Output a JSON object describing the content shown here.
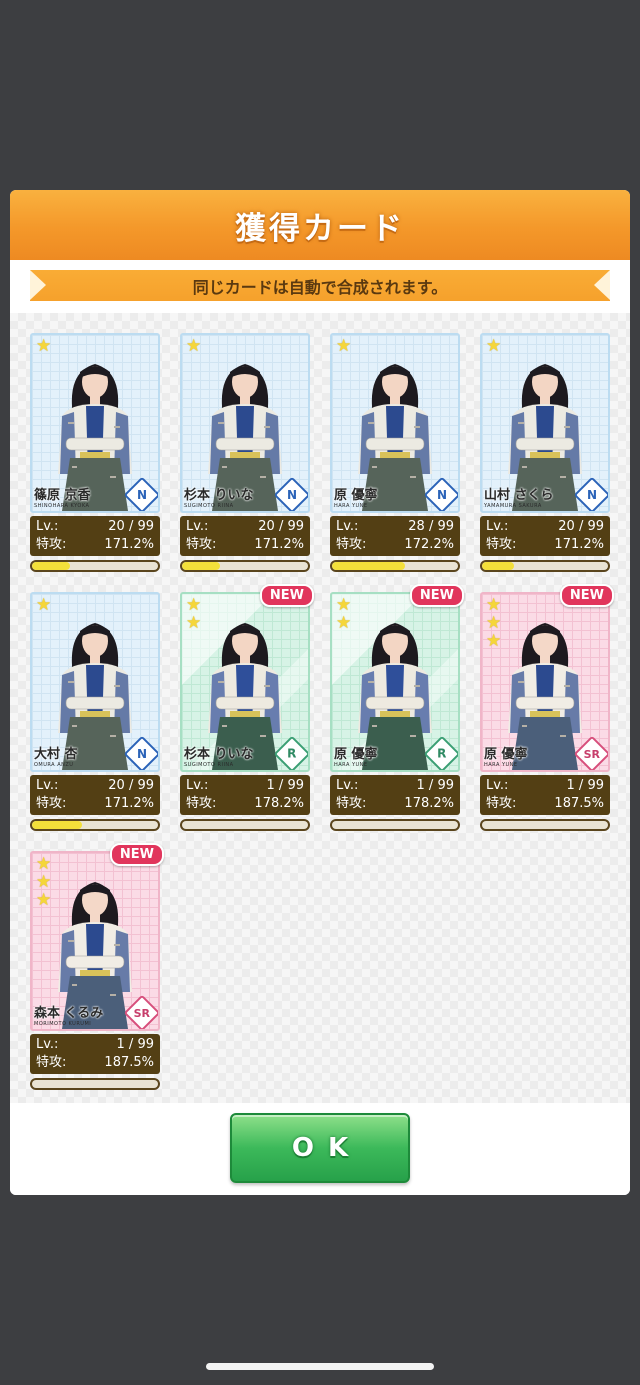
{
  "header": {
    "title": "獲得カード"
  },
  "notice": {
    "text": "同じカードは自動で合成されます。"
  },
  "labels": {
    "level": "Lv.:",
    "attack": "特攻:"
  },
  "cards": [
    {
      "name_jp": "篠原 京香",
      "name_en": "SHINOHARA KYOKA",
      "rarity": "N",
      "stars": 1,
      "new": false,
      "level": "20 / 99",
      "attack": "171.2%",
      "xp": 0.3,
      "palette": "blue"
    },
    {
      "name_jp": "杉本 りいな",
      "name_en": "SUGIMOTO RIINA",
      "rarity": "N",
      "stars": 1,
      "new": false,
      "level": "20 / 99",
      "attack": "171.2%",
      "xp": 0.3,
      "palette": "blue"
    },
    {
      "name_jp": "原 優寧",
      "name_en": "HARA YUNE",
      "rarity": "N",
      "stars": 1,
      "new": false,
      "level": "28 / 99",
      "attack": "172.2%",
      "xp": 0.58,
      "palette": "blue"
    },
    {
      "name_jp": "山村 さくら",
      "name_en": "YAMAMURA SAKURA",
      "rarity": "N",
      "stars": 1,
      "new": false,
      "level": "20 / 99",
      "attack": "171.2%",
      "xp": 0.25,
      "palette": "blue"
    },
    {
      "name_jp": "大村 杏",
      "name_en": "OMURA ANZU",
      "rarity": "N",
      "stars": 1,
      "new": false,
      "level": "20 / 99",
      "attack": "171.2%",
      "xp": 0.4,
      "palette": "blue"
    },
    {
      "name_jp": "杉本 りいな",
      "name_en": "SUGIMOTO RIINA",
      "rarity": "R",
      "stars": 2,
      "new": true,
      "level": "1 / 99",
      "attack": "178.2%",
      "xp": 0,
      "palette": "green"
    },
    {
      "name_jp": "原 優寧",
      "name_en": "HARA YUNE",
      "rarity": "R",
      "stars": 2,
      "new": true,
      "level": "1 / 99",
      "attack": "178.2%",
      "xp": 0,
      "palette": "green"
    },
    {
      "name_jp": "原 優寧",
      "name_en": "HARA YUNE",
      "rarity": "SR",
      "stars": 3,
      "new": true,
      "level": "1 / 99",
      "attack": "187.5%",
      "xp": 0,
      "palette": "pink"
    },
    {
      "name_jp": "森本 くるみ",
      "name_en": "MORIMOTO KURUMI",
      "rarity": "SR",
      "stars": 3,
      "new": true,
      "level": "1 / 99",
      "attack": "187.5%",
      "xp": 0,
      "palette": "pink"
    }
  ],
  "new_badge_label": "NEW",
  "star_icon": "star-icon",
  "ok_button": {
    "label": "OK"
  },
  "colors": {
    "header_orange": "#f4982a",
    "stats_brown": "#533f14",
    "xp_yellow": "#f4e03a",
    "new_badge_red": "#e1355c",
    "ok_green": "#3cb95a"
  }
}
